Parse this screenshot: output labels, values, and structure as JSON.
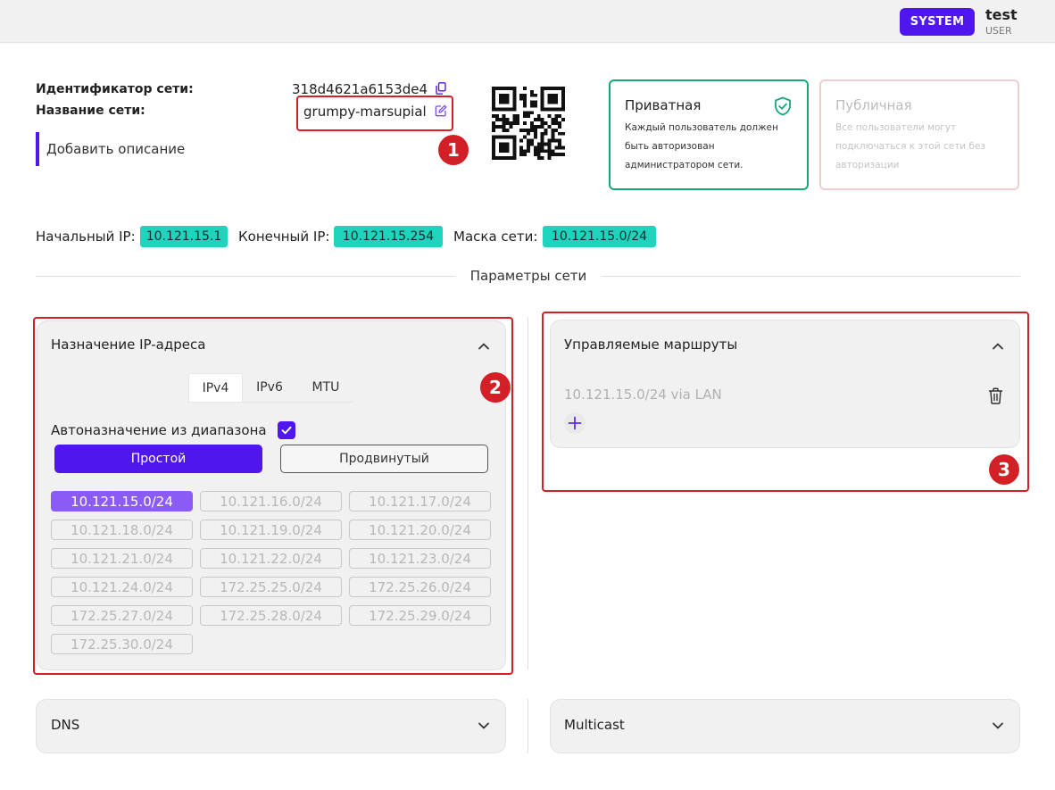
{
  "header": {
    "role_badge": "SYSTEM",
    "user_name": "test",
    "user_role": "USER"
  },
  "network": {
    "id_label": "Идентификатор сети:",
    "id_value": "318d4621a6153de4",
    "name_label": "Название сети:",
    "name_value": "grumpy-marsupial",
    "add_description": "Добавить описание"
  },
  "markers": [
    "1",
    "2",
    "3"
  ],
  "access": {
    "private": {
      "title": "Приватная",
      "desc": "Каждый пользователь должен быть авторизован администратором сети."
    },
    "public": {
      "title": "Публичная",
      "desc": "Все пользователи могут подключаться к этой сети без авторизации"
    }
  },
  "ip_info": {
    "start_label": "Начальный IP:",
    "start_value": "10.121.15.1",
    "end_label": "Конечный IP:",
    "end_value": "10.121.15.254",
    "mask_label": "Маска сети:",
    "mask_value": "10.121.15.0/24"
  },
  "section_title": "Параметры сети",
  "ip_assignment": {
    "title": "Назначение IP-адреса",
    "tabs": [
      "IPv4",
      "IPv6",
      "MTU"
    ],
    "auto_label": "Автоназначение из диапазона",
    "mode_simple": "Простой",
    "mode_advanced": "Продвинутый",
    "subnets": [
      "10.121.15.0/24",
      "10.121.16.0/24",
      "10.121.17.0/24",
      "10.121.18.0/24",
      "10.121.19.0/24",
      "10.121.20.0/24",
      "10.121.21.0/24",
      "10.121.22.0/24",
      "10.121.23.0/24",
      "10.121.24.0/24",
      "172.25.25.0/24",
      "172.25.26.0/24",
      "172.25.27.0/24",
      "172.25.28.0/24",
      "172.25.29.0/24",
      "172.25.30.0/24"
    ]
  },
  "routes": {
    "title": "Управляемые маршруты",
    "items": [
      "10.121.15.0/24 via LAN"
    ]
  },
  "dns": {
    "title": "DNS"
  },
  "multicast": {
    "title": "Multicast"
  },
  "colors": {
    "accent": "#4f17ee",
    "teal_chip": "#1ed4bd",
    "private_border": "#14a87a",
    "public_border": "#f2cccc",
    "annotation_red": "#d32027",
    "selected_subnet": "#8a5cf5"
  },
  "icons": [
    "copy-icon",
    "edit-icon",
    "qr-code-icon",
    "shield-check-icon",
    "chevron-up-icon",
    "chevron-down-icon",
    "trash-icon",
    "plus-icon",
    "check-icon"
  ]
}
